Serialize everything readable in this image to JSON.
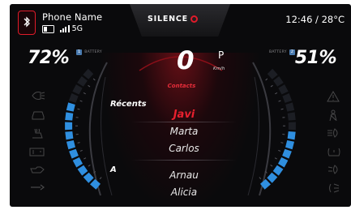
{
  "status_bar": {
    "phone_name": "Phone Name",
    "network": "5G",
    "brand": "SILENCE",
    "time_temp": "12:46 / 28°C"
  },
  "battery": {
    "left": {
      "percent_text": "72%",
      "label": "BATTERY",
      "chip": "1",
      "level": 0.72
    },
    "right": {
      "percent_text": "51%",
      "label": "BATTERY",
      "chip": "2",
      "level": 0.51
    }
  },
  "drive": {
    "speed": "0",
    "gear": "P",
    "unit": "Km/h"
  },
  "contacts": {
    "title": "Contacts",
    "sections": [
      {
        "label": "Récents",
        "names": [
          "Javi",
          "Marta",
          "Carlos"
        ]
      },
      {
        "label": "A",
        "names": [
          "Arnau",
          "Alicia"
        ]
      }
    ],
    "selected": "Javi"
  },
  "left_icons": [
    "headlight-icon",
    "car-front-icon",
    "seat-heat-icon",
    "battery-warning-icon",
    "oil-can-icon",
    "wrench-icon"
  ],
  "right_icons": [
    "warning-triangle-icon",
    "seatbelt-icon",
    "high-beam-icon",
    "tire-pressure-icon",
    "fog-light-icon",
    "low-beam-icon"
  ],
  "colors": {
    "accent_red": "#e01b2a",
    "gauge_blue": "#2f8fe0",
    "background": "#0a0a0c"
  }
}
